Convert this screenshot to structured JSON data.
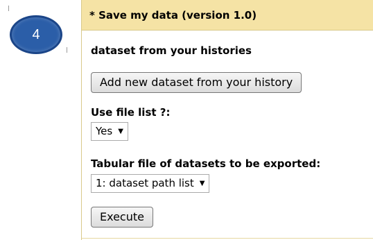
{
  "step_badge": {
    "number": "4"
  },
  "panel": {
    "title": "* Save my data (version 1.0)",
    "section_label": "dataset from your histories",
    "add_dataset_button": "Add new dataset from your history",
    "use_file_list": {
      "label": "Use file list ?:",
      "selected": "Yes"
    },
    "tabular_file": {
      "label": "Tabular file of datasets to be exported:",
      "selected": "1: dataset path list"
    },
    "execute_button": "Execute"
  },
  "colors": {
    "header_bg": "#f5e3a5",
    "badge_bg": "#2b5ea8"
  },
  "icons": {
    "dropdown": "caret-down-icon"
  }
}
